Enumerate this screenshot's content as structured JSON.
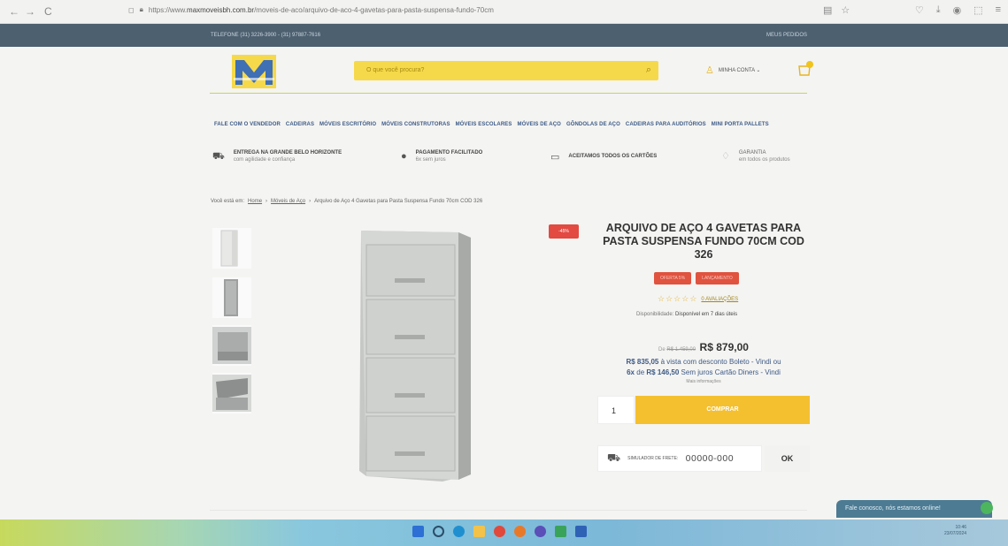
{
  "browser": {
    "url_prefix": "https://www.",
    "url_domain": "maxmoveisbh.com.br",
    "url_path": "/moveis-de-aco/arquivo-de-aco-4-gavetas-para-pasta-suspensa-fundo-70cm"
  },
  "topbar": {
    "phone": "TELEFONE (31) 3226-3900 - (31) 97887-7616",
    "orders": "MEUS PEDIDOS"
  },
  "header": {
    "search_placeholder": "O que você procura?",
    "account_label": "MINHA CONTA ⌄",
    "cart_count": "0"
  },
  "menu": [
    "FALE COM O VENDEDOR",
    "CADEIRAS",
    "MÓVEIS ESCRITÓRIO",
    "MÓVEIS CONSTRUTORAS",
    "MÓVEIS ESCOLARES",
    "MÓVEIS DE AÇO",
    "GÔNDOLAS DE AÇO",
    "CADEIRAS PARA AUDITÓRIOS",
    "MINI PORTA PALLETS"
  ],
  "features": [
    {
      "title": "ENTREGA NA GRANDE BELO HORIZONTE",
      "sub": "com agilidade e confiança",
      "icon": "truck-icon"
    },
    {
      "title": "PAGAMENTO FACILITADO",
      "sub": "6x sem juros",
      "icon": "dollar-icon"
    },
    {
      "title": "ACEITAMOS TODOS OS CARTÕES",
      "sub": "",
      "icon": "card-icon"
    },
    {
      "title": "GARANTIA",
      "sub": "em todos os produtos",
      "icon": "shield-icon"
    }
  ],
  "breadcrumb": {
    "prefix": "Você está em:",
    "home": "Home",
    "category": "Móveis de Aço",
    "current": "Arquivo de Aço 4 Gavetas para Pasta Suspensa Fundo 70cm COD 326"
  },
  "product": {
    "discount_tag": "-45%",
    "title": "ARQUIVO DE AÇO 4 GAVETAS PARA PASTA SUSPENSA FUNDO 70CM COD 326",
    "badges": [
      "OFERTA 5%",
      "LANÇAMENTO"
    ],
    "rating_count": "0 AVALIAÇÕES",
    "availability_label": "Disponibilidade:",
    "availability_value": "Disponível em 7 dias úteis",
    "old_price_prefix": "De",
    "old_price": "R$ 1.459,00",
    "price": "R$ 879,00",
    "cash_price": "R$ 835,05",
    "cash_text": "à vista com desconto Boleto - Vindi ou",
    "installments_count": "6x",
    "installments_mid": "de",
    "installment_value": "R$ 146,50",
    "installments_text": "Sem juros Cartão Diners - Vindi",
    "more_info": "Mais informações",
    "quantity": "1",
    "buy_label": "COMPRAR",
    "shipping_label": "SIMULADOR DE FRETE:",
    "shipping_placeholder": "00000-000",
    "ok_label": "OK"
  },
  "chat": {
    "label": "Fale conosco, nós estamos online!"
  },
  "taskbar": {
    "time": "10:46",
    "date": "23/07/2024"
  }
}
